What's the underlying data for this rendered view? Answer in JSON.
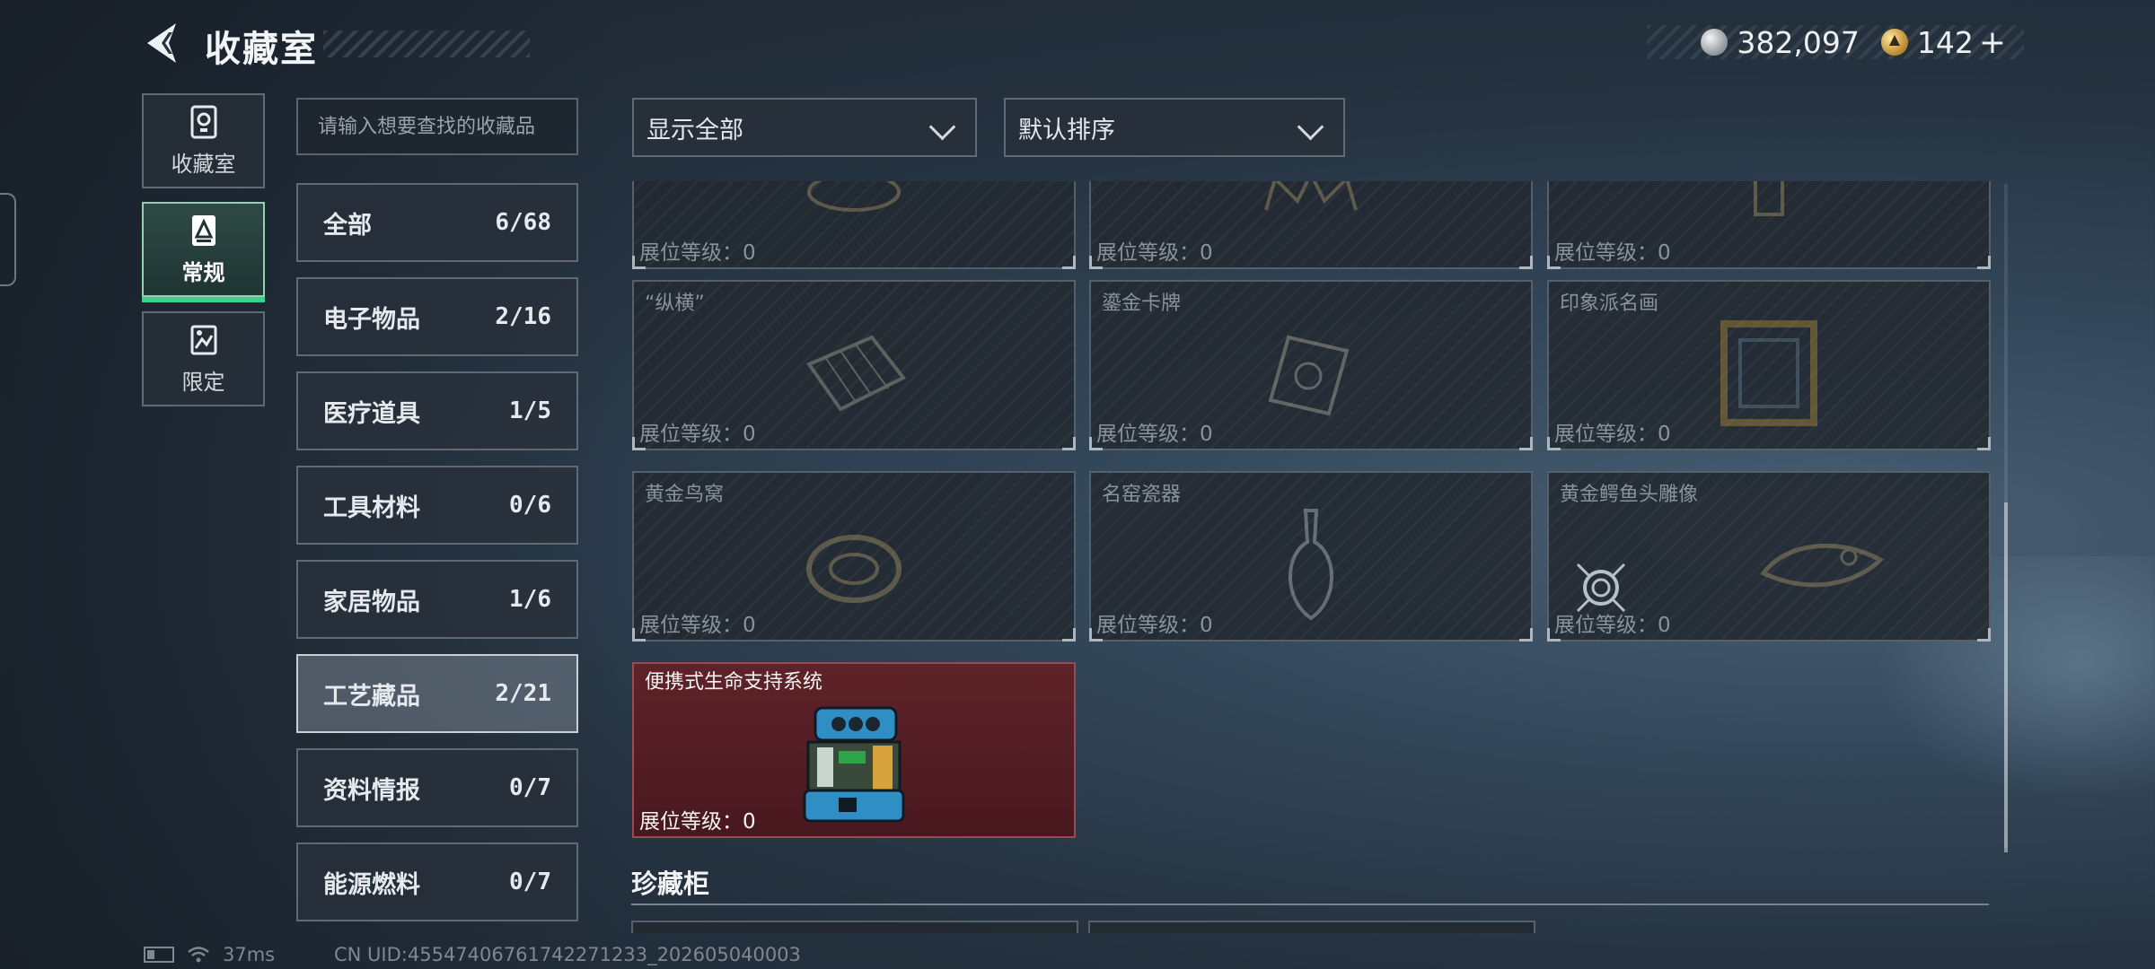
{
  "header": {
    "title": "收藏室"
  },
  "currency": {
    "silver": "382,097",
    "gold": "142",
    "plus": "+"
  },
  "rail": [
    {
      "label": "收藏室",
      "icon": "trophy-icon",
      "active": false
    },
    {
      "label": "常规",
      "icon": "document-icon",
      "active": true
    },
    {
      "label": "限定",
      "icon": "image-icon",
      "active": false
    }
  ],
  "search": {
    "placeholder": "请输入想要查找的收藏品"
  },
  "filters": {
    "show": "显示全部",
    "sort": "默认排序"
  },
  "subcategories": [
    {
      "name": "全部",
      "count": "6/68"
    },
    {
      "name": "电子物品",
      "count": "2/16"
    },
    {
      "name": "医疗道具",
      "count": "1/5"
    },
    {
      "name": "工具材料",
      "count": "0/6"
    },
    {
      "name": "家居物品",
      "count": "1/6"
    },
    {
      "name": "工艺藏品",
      "count": "2/21",
      "active": true
    },
    {
      "name": "资料情报",
      "count": "0/7"
    },
    {
      "name": "能源燃料",
      "count": "0/7"
    }
  ],
  "level_label": "展位等级：",
  "cards": [
    {
      "name": "",
      "level": "0",
      "icon": "bowl-icon"
    },
    {
      "name": "",
      "level": "0",
      "icon": "crown-icon"
    },
    {
      "name": "",
      "level": "0",
      "icon": "statue-icon"
    },
    {
      "name": "“纵横”",
      "level": "0",
      "icon": "chessboard-icon"
    },
    {
      "name": "鎏金卡牌",
      "level": "0",
      "icon": "card-icon"
    },
    {
      "name": "印象派名画",
      "level": "0",
      "icon": "painting-icon"
    },
    {
      "name": "黄金鸟窝",
      "level": "0",
      "icon": "nest-icon"
    },
    {
      "name": "名窑瓷器",
      "level": "0",
      "icon": "vase-icon"
    },
    {
      "name": "黄金鳄鱼头雕像",
      "level": "0",
      "icon": "crocodile-icon",
      "target": true
    },
    {
      "name": "便携式生命支持系统",
      "level": "0",
      "icon": "life-support-icon",
      "unlocked": true
    }
  ],
  "section": {
    "title": "珍藏柜"
  },
  "status": {
    "ping": "37ms",
    "uid": "CN UID:4554740676174227​1233_202605040003"
  }
}
